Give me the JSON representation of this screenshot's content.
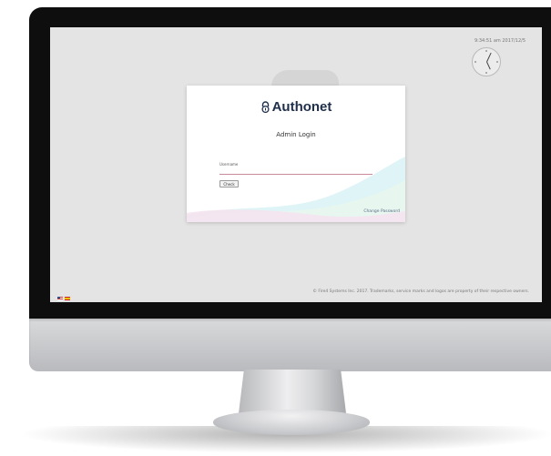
{
  "screen": {
    "datetime": "9:34:51 am 2017/12/5",
    "copyright": "© Fire4 Systems Inc. 2017. Trademarks, service marks and logos are property of their respective owners.",
    "language_flags": [
      {
        "name": "us-flag-icon",
        "lang": "English"
      },
      {
        "name": "spain-flag-icon",
        "lang": "Spanish"
      }
    ]
  },
  "login": {
    "logo_text": "Authonet",
    "title": "Admin Login",
    "username_label": "Username",
    "username_value": "",
    "check_label": "Check",
    "change_password_label": "Change Password"
  },
  "colors": {
    "logo": "#1f2f4b",
    "wave_cyan": "#dff4f6",
    "wave_pink": "#f4e3ef",
    "screen_bg": "#e4e4e4",
    "bezel": "#0e0e0e"
  }
}
